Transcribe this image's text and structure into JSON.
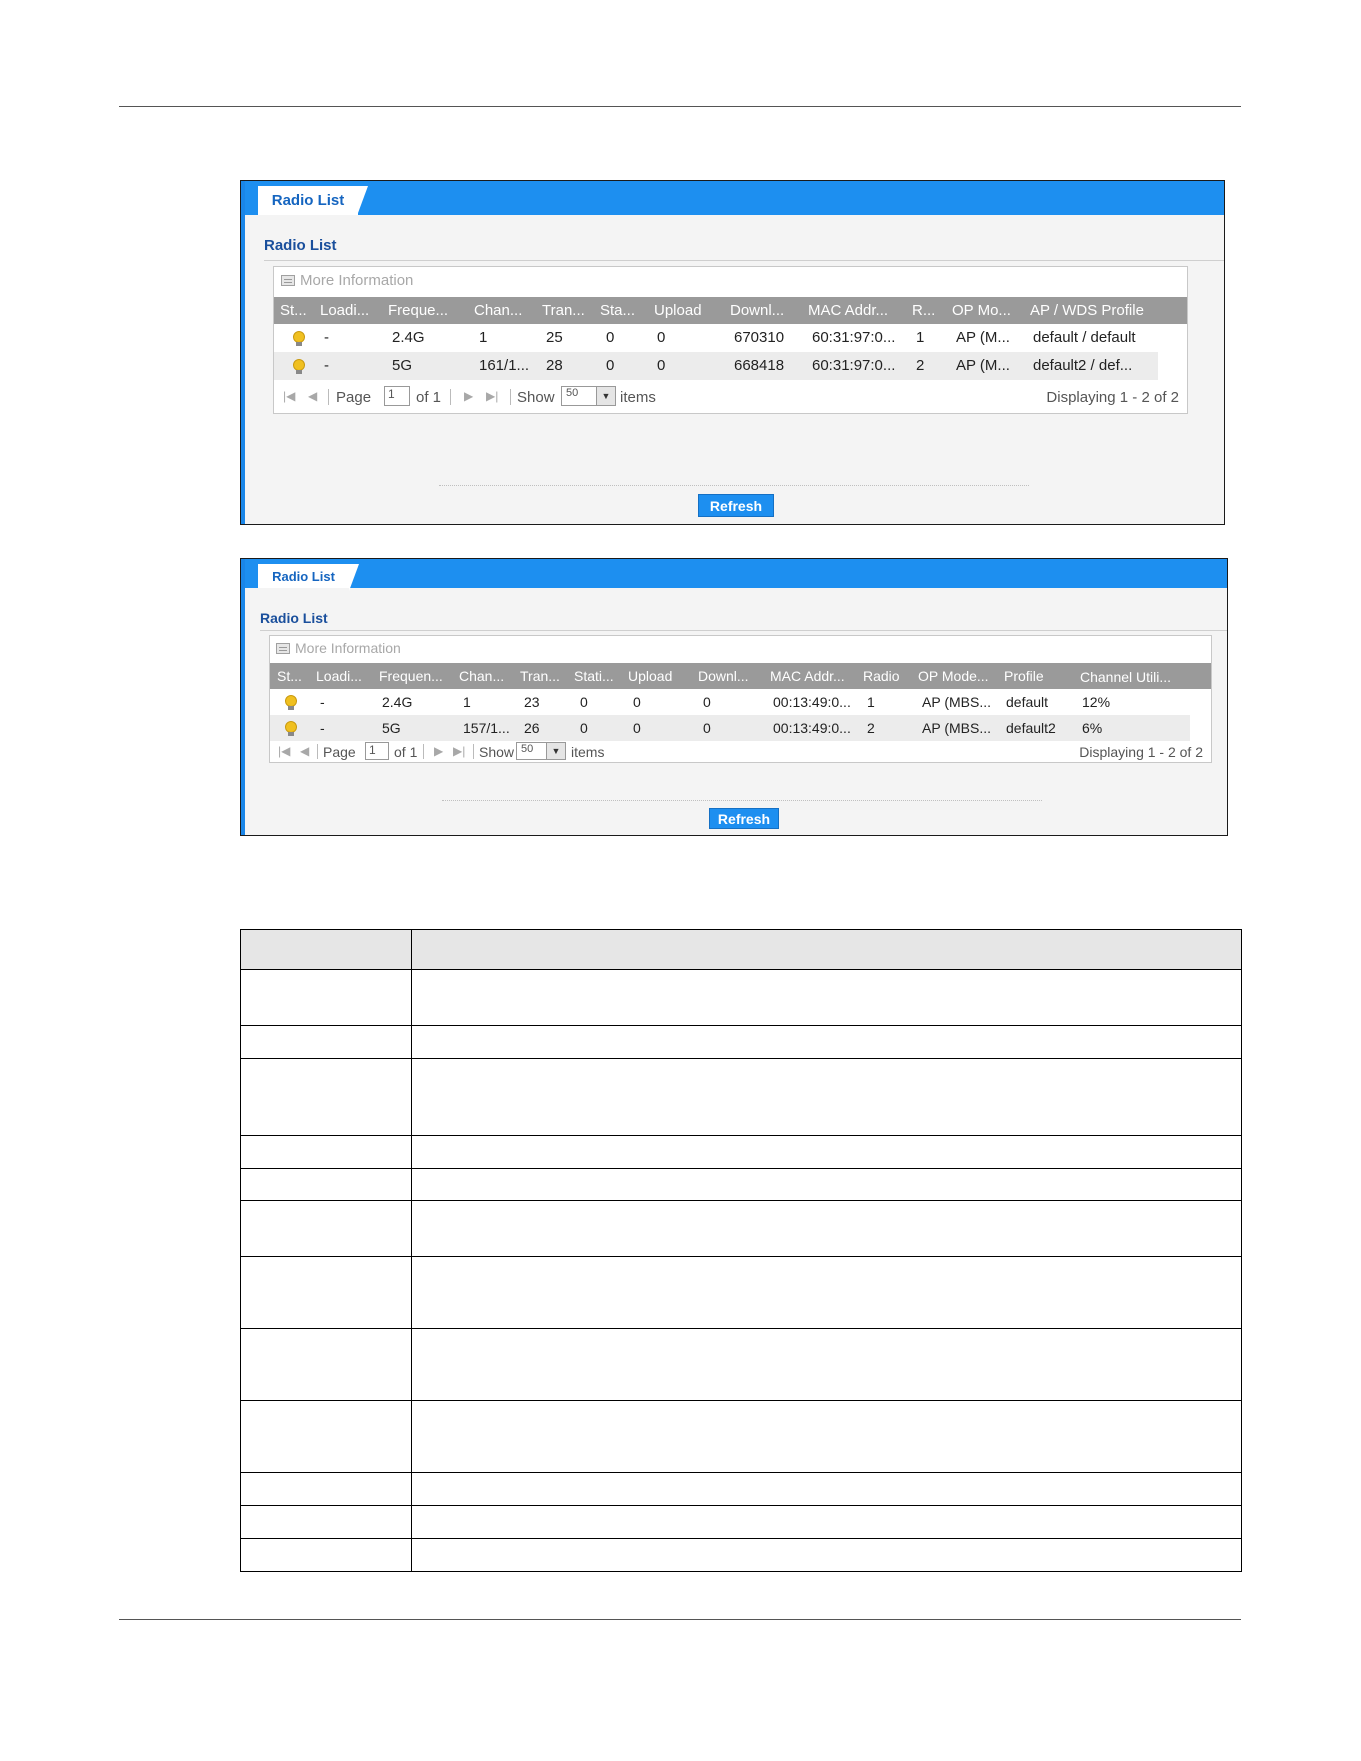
{
  "panel1": {
    "tab_label": "Radio List",
    "section_title": "Radio List",
    "more_info": "More Information",
    "columns": [
      "St...",
      "Loadi...",
      "Freque...",
      "Chan...",
      "Tran...",
      "Sta...",
      "Upload",
      "Downl...",
      "MAC Addr...",
      "R...",
      "OP Mo...",
      "AP / WDS Profile"
    ],
    "rows": [
      [
        "",
        "-",
        "2.4G",
        "1",
        "25",
        "0",
        "0",
        "670310",
        "60:31:97:0...",
        "1",
        "AP (M...",
        "default / default"
      ],
      [
        "",
        "-",
        "5G",
        "161/1...",
        "28",
        "0",
        "0",
        "668418",
        "60:31:97:0...",
        "2",
        "AP (M...",
        "default2 / def..."
      ]
    ],
    "pager": {
      "page_label": "Page",
      "page_value": "1",
      "of_label": "of 1",
      "show_label": "Show",
      "show_value": "50",
      "items_label": "items",
      "displaying": "Displaying 1 - 2 of 2"
    },
    "refresh_label": "Refresh"
  },
  "panel2": {
    "tab_label": "Radio List",
    "section_title": "Radio List",
    "more_info": "More Information",
    "columns": [
      "St...",
      "Loadi...",
      "Frequen...",
      "Chan...",
      "Tran...",
      "Stati...",
      "Upload",
      "Downl...",
      "MAC Addr...",
      "Radio",
      "OP Mode...",
      "Profile",
      "Channel Utili..."
    ],
    "rows": [
      [
        "",
        "-",
        "2.4G",
        "1",
        "23",
        "0",
        "0",
        "0",
        "00:13:49:0...",
        "1",
        "AP (MBS...",
        "default",
        "12%"
      ],
      [
        "",
        "-",
        "5G",
        "157/1...",
        "26",
        "0",
        "0",
        "0",
        "00:13:49:0...",
        "2",
        "AP (MBS...",
        "default2",
        "6%"
      ]
    ],
    "pager": {
      "page_label": "Page",
      "page_value": "1",
      "of_label": "of 1",
      "show_label": "Show",
      "show_value": "50",
      "items_label": "items",
      "displaying": "Displaying 1 - 2 of 2"
    },
    "refresh_label": "Refresh"
  },
  "colors": {
    "accent": "#1d8ff0",
    "header_gray": "#9a9a9a",
    "title_blue": "#1a4f9c"
  },
  "icons": {
    "status": "lightbulb-icon",
    "more_info": "list-icon"
  }
}
